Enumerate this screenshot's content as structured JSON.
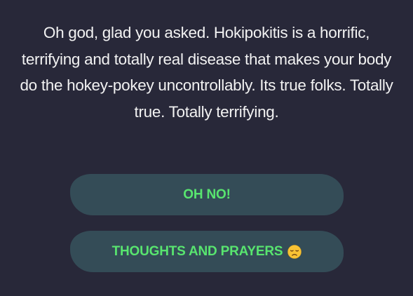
{
  "message": {
    "text": "Oh god, glad you asked. Hokipokitis is a horrific, terrifying and totally real disease that makes your body do the hokey-pokey uncontrollably. Its true folks. Totally true. Totally terrifying."
  },
  "replies": [
    {
      "label": "OH NO!"
    },
    {
      "label": "THOUGHTS AND PRAYERS",
      "icon": "disappointed-face-emoji"
    }
  ],
  "colors": {
    "background": "#282839",
    "message_text": "#f2f2f2",
    "button_bg": "#344c57",
    "button_text": "#58e56f"
  }
}
